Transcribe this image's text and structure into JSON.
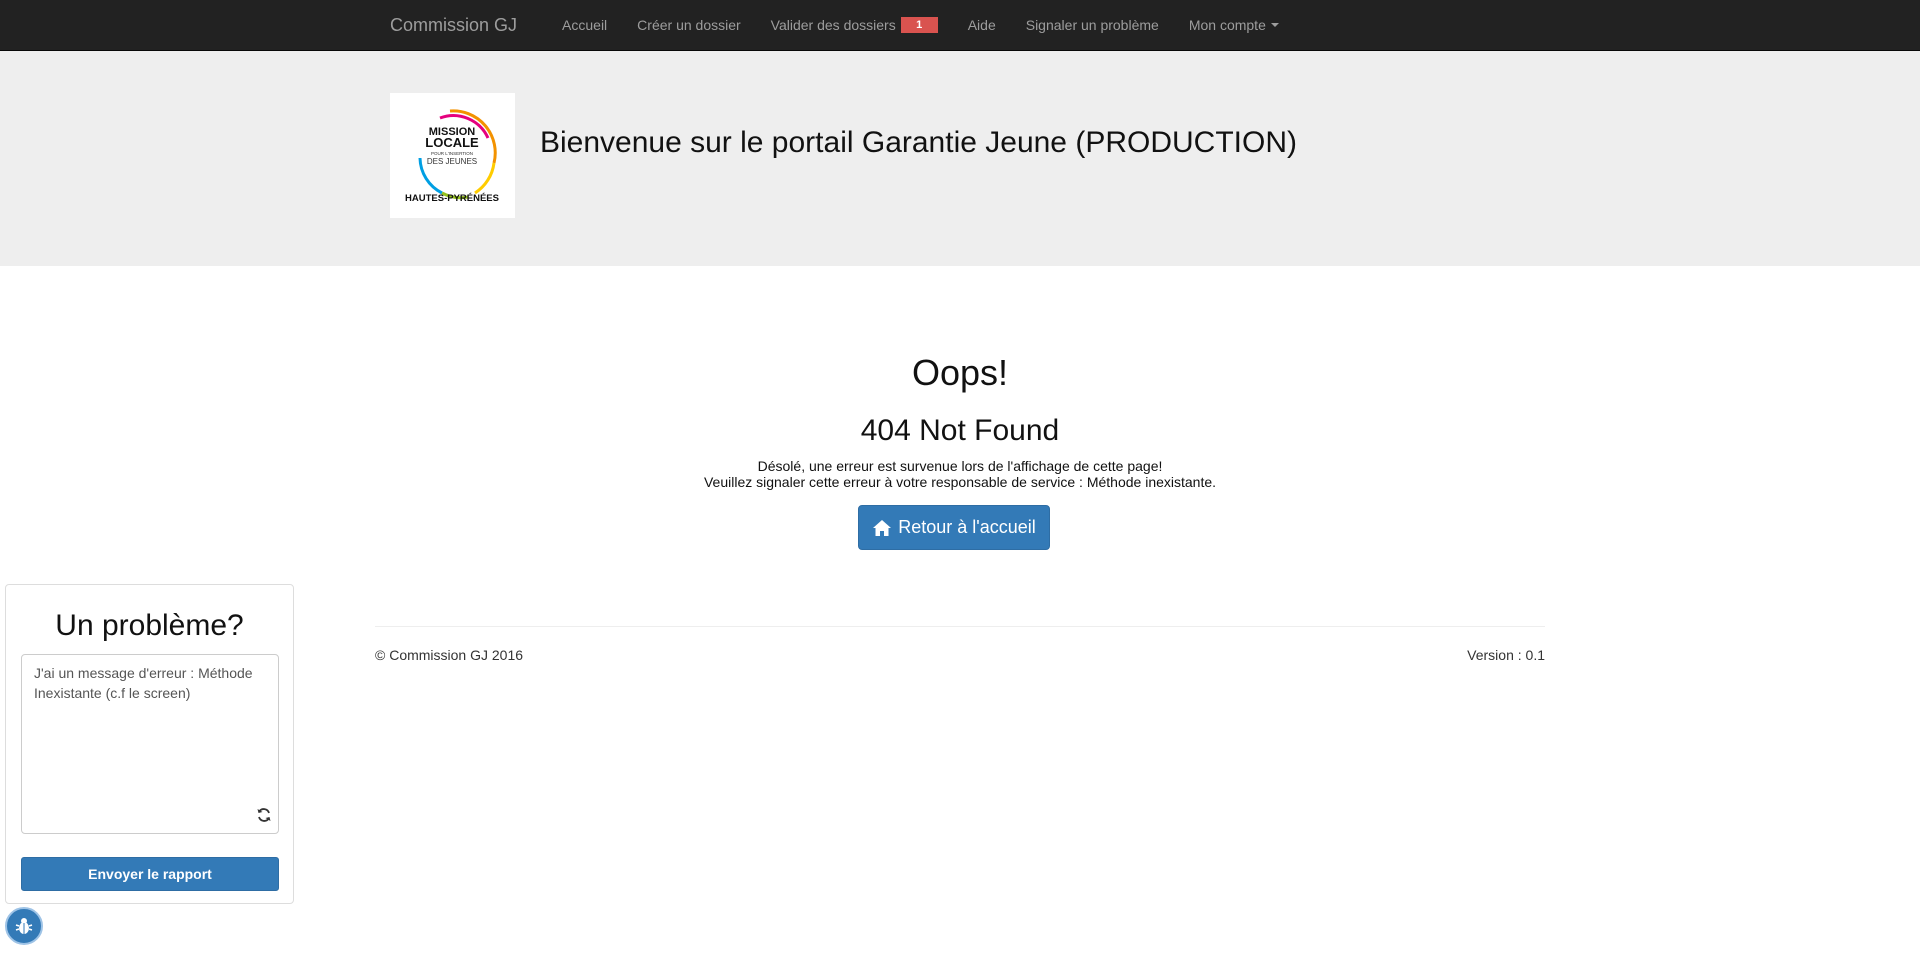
{
  "navbar": {
    "brand": "Commission GJ",
    "items": [
      {
        "label": "Accueil"
      },
      {
        "label": "Créer un dossier"
      },
      {
        "label": "Valider des dossiers",
        "badge": "1"
      },
      {
        "label": "Aide"
      },
      {
        "label": "Signaler un problème"
      },
      {
        "label": "Mon compte"
      }
    ]
  },
  "jumbotron": {
    "logo_lines": [
      "MISSION",
      "LOCALE",
      "POUR L'INSERTION",
      "DES JEUNES",
      "HAUTES-PYRÉNÉES"
    ],
    "title": "Bienvenue sur le portail Garantie Jeune (PRODUCTION)"
  },
  "error": {
    "heading": "Oops!",
    "status": "404 Not Found",
    "line1": "Désolé, une erreur est survenue lors de l'affichage de cette page!",
    "line2": "Veuillez signaler cette erreur à votre responsable de service : Méthode inexistante.",
    "home_button": "Retour à l'accueil"
  },
  "footer": {
    "copyright": "© Commission GJ 2016",
    "version": "Version : 0.1"
  },
  "problem_panel": {
    "title": "Un problème?",
    "textarea_value": "J'ai un message d'erreur : Méthode Inexistante (c.f le screen)",
    "send_button": "Envoyer le rapport"
  },
  "colors": {
    "navbar_bg": "#222222",
    "primary": "#337ab7",
    "badge": "#d9534f",
    "jumbotron_bg": "#eeeeee"
  }
}
